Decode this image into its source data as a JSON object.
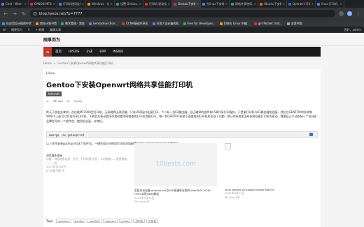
{
  "browser": {
    "tabs": [
      {
        "label": "Chat · Wise · Write",
        "color": "#7c6cf2"
      },
      {
        "label": "CANON MF290...",
        "color": "#d93025"
      },
      {
        "label": "打印机使用佳能...",
        "color": "#4285f4"
      },
      {
        "label": "Windows - 佳能...",
        "color": "#f29900"
      },
      {
        "label": "设置 Gentoo...",
        "color": "#34a853"
      },
      {
        "label": "打印机 驱动佳...",
        "color": "#d93025"
      },
      {
        "label": "Gentoo下安装...",
        "color": "#c0392b",
        "active": true
      },
      {
        "label": "在linux下安装...",
        "color": "#4285f4"
      },
      {
        "label": "网络共享使用...",
        "color": "#34a853"
      },
      {
        "label": "Ubuntu下安装...",
        "color": "#e8710a"
      },
      {
        "label": "Openwrt 打印...",
        "color": "#1a73e8"
      },
      {
        "label": "linux 打印机...",
        "color": "#4285f4"
      }
    ],
    "url": "blog.hyeos.net/?p=7777",
    "bookmarks": [
      {
        "label": "在应用设计指南中学",
        "color": "#4285f4"
      },
      {
        "label": "商业计划书商",
        "color": "#f29900"
      },
      {
        "label": "教学管理 · 我说",
        "color": "#34a853"
      },
      {
        "label": "GentooFunction...",
        "color": "#7c6cf2"
      },
      {
        "label": "CCNA基础共享机",
        "color": "#d93025"
      },
      {
        "label": "开发人员必备的机",
        "color": "#4285f4"
      },
      {
        "label": "Free for developer...",
        "color": "#34a853"
      },
      {
        "label": "如何在 Linux 中编...",
        "color": "#f29900"
      },
      {
        "label": "get Pocket chat...",
        "color": "#d93025"
      },
      {
        "label": "全部书签",
        "color": "#9aa0a6"
      }
    ]
  },
  "wp_admin": {
    "items": [
      "W",
      "随便而为",
      "0",
      "+ 新建",
      "编辑文章"
    ],
    "right": "您好，admin"
  },
  "site": {
    "brand": "随事而为",
    "menu": [
      "首页",
      "HYEOS",
      "小店",
      "ERP",
      "INSIDE"
    ],
    "breadcrumb": [
      "Home",
      "»",
      "Gentoo下安装Openwrt网络共享佳能打印机"
    ]
  },
  "post": {
    "category": "Linux",
    "title": "Gentoo下安装Openwrt网络共享佳能打印机",
    "tag_badge": "Internet",
    "date": "3年 ago",
    "author": "hyeos",
    "paragraph": "昨天于朋友处拿到一台佳能MF2900型打印机，无网络和无线功能，只有USB接口连接打印，个人有一台K3路由器，自己编译的固件有USB共享打印服务，于是来打印机与K3路由器相连接，然后在GENTOO的系统和WIN10上面可以实现共享打印机，下载官方驱动程序添加时使用网络查找打印机功能打印，哪一包GENTOO系统下面查找到打印机时出现了问题，默认的系统里没有安装佳能打印机的驱动，需要自己手动安装一个支持多品牌型号的一个软件包，使用很全面，非常好。",
    "code": "emerge -av gutenprint",
    "after_code": "以上命令安装gutenprint这个软件包，一键完成后在使用打印机添加配置时会有可选的佳能打印机品牌型号。",
    "related": [
      {
        "title": "浏览器多连接",
        "lines": [
          "功能：浏览器多连接、文件、打印机等 信息：公司电脑——家庭电脑——一机...",
          "2021年5月28日",
          "在\"仿番下载\"中"
        ]
      },
      {
        "title": "家庭多台设备 android tvs及PVE直通有深思的LibreELEC KODI HTPC实现HDMI输出",
        "lines": [
          "2021年3月30日",
          "在\"Linux\"中"
        ]
      },
      {
        "title": "linux gentoo virtualbox install MacOS",
        "lines": [
          "2021年8月21日",
          "在\"Linux\"中"
        ]
      }
    ],
    "thumb_text": "10bests.com",
    "tags_label": "Tags:",
    "tags": [
      "common",
      "gentoo",
      "mp2900",
      "openwrt",
      "printer",
      "打印机",
      "打印机"
    ]
  }
}
